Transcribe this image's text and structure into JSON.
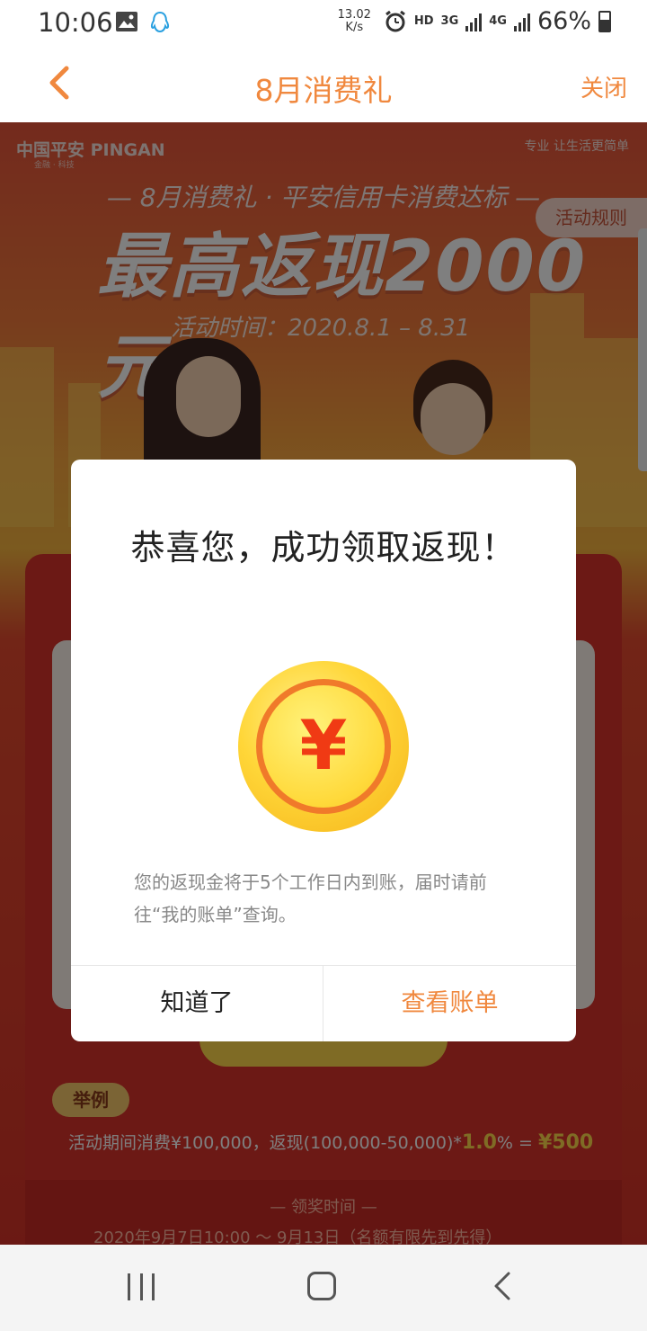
{
  "status_bar": {
    "time": "10:06",
    "net_speed_value": "13.02",
    "net_speed_unit": "K/s",
    "hd": "HD",
    "net_3g": "3G",
    "net_4g": "4G",
    "battery": "66%"
  },
  "navbar": {
    "title": "8月消费礼",
    "close_label": "关闭"
  },
  "banner": {
    "brand": "中国平安 PINGAN",
    "brand_sub": "金融 · 科技",
    "slogan": "专业 让生活更简单",
    "subtitle": "— 8月消费礼 · 平安信用卡消费达标 —",
    "headline": "最高返现2000元",
    "activity_time": "活动时间：2020.8.1 – 8.31",
    "rules_label": "活动规则"
  },
  "example": {
    "tag": "举例",
    "text": "活动期间消费¥100,000，返现(100,000-50,000)*",
    "rate": "1.0",
    "rate_suffix": "% = ",
    "amount": "¥500"
  },
  "award": {
    "title": "— 领奖时间 —",
    "time": "2020年9月7日10:00 ～ 9月13日（名额有限先到先得）"
  },
  "modal": {
    "title": "恭喜您，成功领取返现！",
    "coin_symbol": "¥",
    "description": "您的返现金将于5个工作日内到账，届时请前往“我的账单”查询。",
    "ok_label": "知道了",
    "view_label": "查看账单"
  },
  "colors": {
    "accent": "#f0883e",
    "banner_red": "#d9322a",
    "coin_gold": "#ffd638"
  }
}
